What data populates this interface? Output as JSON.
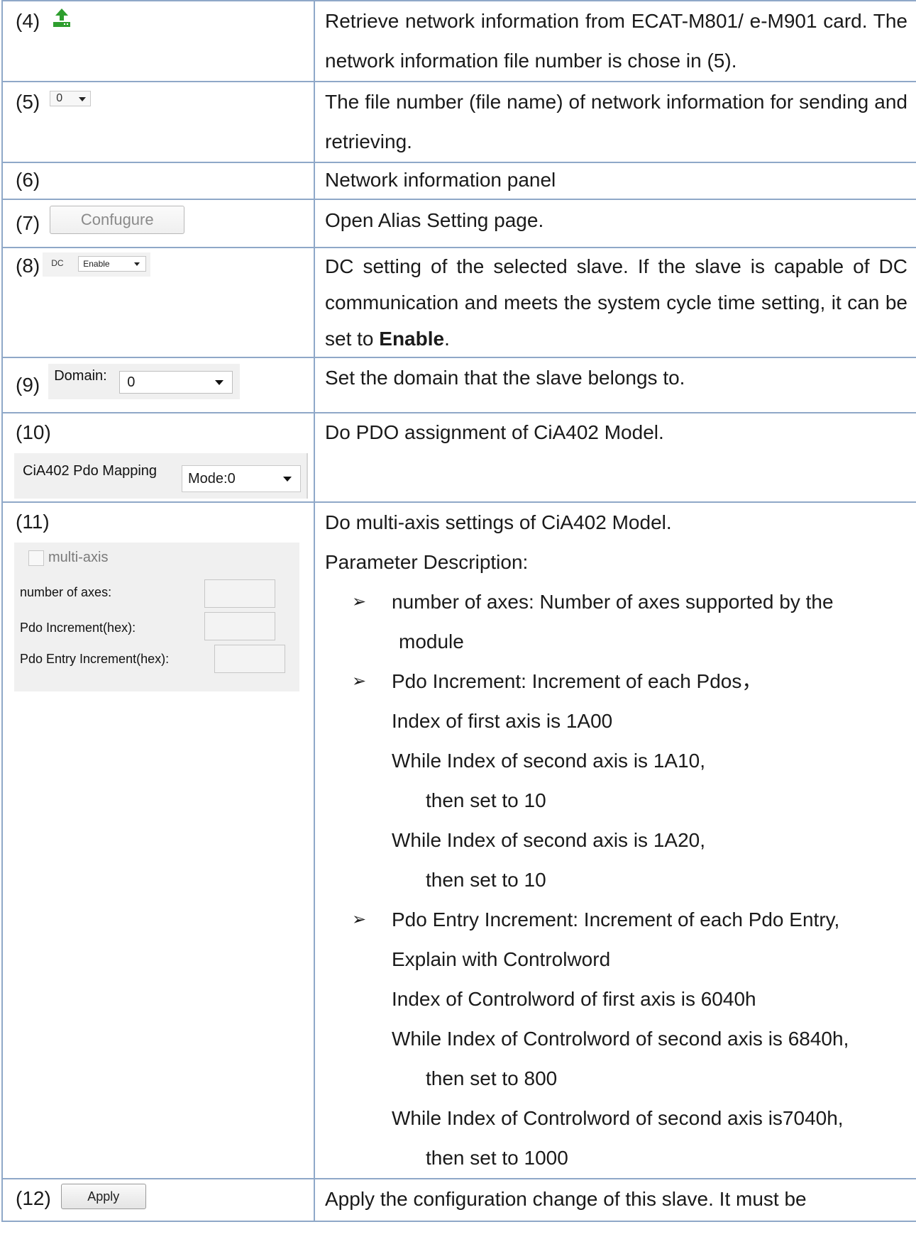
{
  "rows": {
    "r4": {
      "num": "(4)",
      "icon": "upload-icon",
      "desc": "Retrieve network information from ECAT-M801/ e-M901 card. The network information file number is chose in (5)."
    },
    "r5": {
      "num": "(5)",
      "combo_value": "0",
      "desc": "The file number (file name) of network information for sending and retrieving."
    },
    "r6": {
      "num": "(6)",
      "desc": "Network information panel"
    },
    "r7": {
      "num": "(7)",
      "button_label": "Confugure",
      "desc": "Open Alias Setting page."
    },
    "r8": {
      "num": "(8)",
      "dc_label": "DC",
      "dc_value": "Enable",
      "desc_pre": "DC setting of the selected slave. If the slave is capable of DC communication and meets the system cycle time setting, it can be set to ",
      "desc_bold": "Enable",
      "desc_post": "."
    },
    "r9": {
      "num": "(9)",
      "domain_label": "Domain:",
      "domain_value": "0",
      "desc": "Set the domain that the slave belongs to."
    },
    "r10": {
      "num": "(10)",
      "cia_label": "CiA402 Pdo Mapping",
      "cia_value": "Mode:0",
      "desc": "Do PDO assignment of CiA402 Model."
    },
    "r11": {
      "num": "(11)",
      "multi_axis_label": "multi-axis",
      "field1_label": "number of axes:",
      "field2_label": "Pdo Increment(hex):",
      "field3_label": "Pdo Entry Increment(hex):",
      "line1": "Do multi-axis settings of CiA402 Model.",
      "line2": "Parameter Description:",
      "b1a": "number of axes: Number of axes supported by the",
      "b1b": "module",
      "b2a": "Pdo Increment: Increment of each Pdos，",
      "b2b": "Index of first axis is 1A00",
      "b2c": "While Index of second axis is 1A10,",
      "b2d": "then set to 10",
      "b2e": "While Index of second axis is 1A20,",
      "b2f": "then set to 10",
      "b3a": "Pdo Entry Increment: Increment of each Pdo Entry,",
      "b3b": "Explain with Controlword",
      "b3c": "Index of Controlword of first axis is 6040h",
      "b3d": "While Index of Controlword of second axis is 6840h,",
      "b3e": "then set to 800",
      "b3f": "While Index of Controlword of second axis is7040h,",
      "b3g": "then set to 1000"
    },
    "r12": {
      "num": "(12)",
      "button_label": "Apply",
      "desc": "Apply the configuration change of this slave. It must be"
    }
  },
  "bullet_glyph": "➢",
  "colors": {
    "border": "#8fa8c8",
    "icon_green": "#2e9e2e"
  }
}
